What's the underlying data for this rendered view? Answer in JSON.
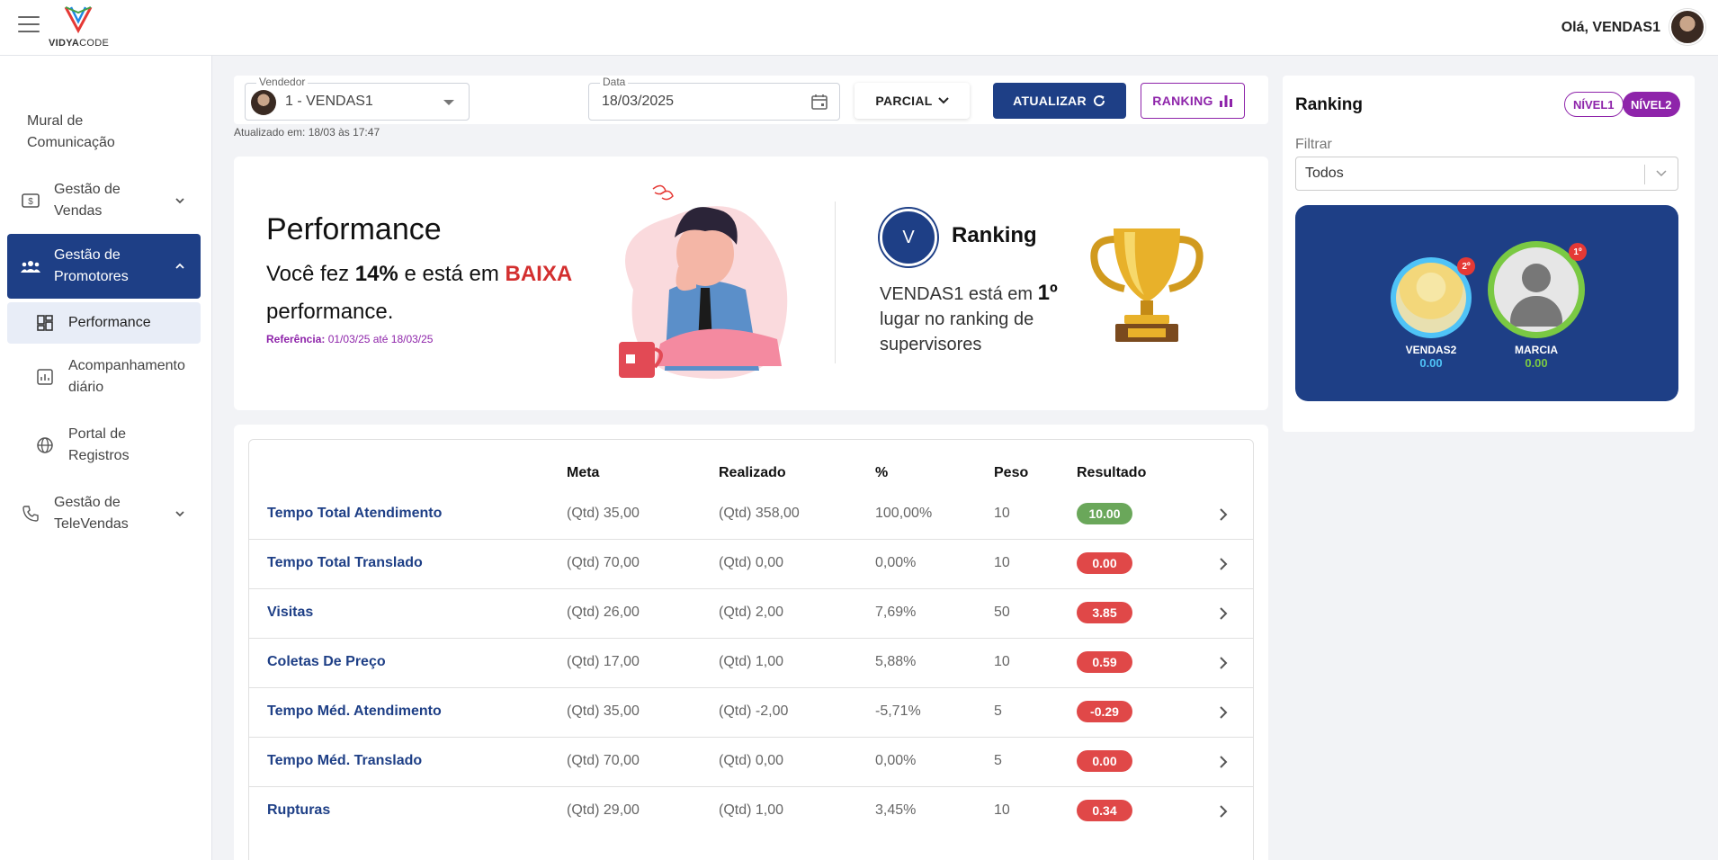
{
  "header": {
    "logo_brand": "VIDYA",
    "logo_brand_light": "CODE",
    "greeting": "Olá, VENDAS1"
  },
  "sidebar": {
    "items": [
      {
        "label": "Mural de Comunicação",
        "icon": "none"
      },
      {
        "label": "Gestão de Vendas",
        "icon": "dollar-icon"
      },
      {
        "label": "Gestão de Promotores",
        "icon": "users-icon"
      },
      {
        "label": "Performance",
        "icon": "dashboard-icon"
      },
      {
        "label": "Acompanhamento diário",
        "icon": "chart-icon"
      },
      {
        "label": "Portal de Registros",
        "icon": "globe-icon"
      },
      {
        "label": "Gestão de TeleVendas",
        "icon": "phone-icon"
      }
    ]
  },
  "filters": {
    "vendedor_label": "Vendedor",
    "vendedor_value": "1 - VENDAS1",
    "data_label": "Data",
    "data_value": "18/03/2025",
    "parcial_label": "PARCIAL",
    "atualizar_label": "ATUALIZAR",
    "ranking_label": "RANKING",
    "updated_text": "Atualizado em: 18/03 às 17:47"
  },
  "performance": {
    "title": "Performance",
    "line_prefix": "Você fez ",
    "percent": "14%",
    "line_mid": " e está em ",
    "level": "BAIXA",
    "line_suffix": "performance.",
    "ref_label": "Referência:",
    "ref_range": " 01/03/25 até 18/03/25",
    "badge_letter": "V",
    "ranking_title": "Ranking",
    "ranking_text_prefix": "VENDAS1 está em ",
    "ranking_position": "1º",
    "ranking_text_suffix": " lugar no ranking de supervisores"
  },
  "table": {
    "headers": {
      "meta": "Meta",
      "realizado": "Realizado",
      "pct": "%",
      "peso": "Peso",
      "resultado": "Resultado"
    },
    "rows": [
      {
        "name": "Tempo Total Atendimento",
        "meta": "(Qtd) 35,00",
        "realizado": "(Qtd) 358,00",
        "pct": "100,00%",
        "peso": "10",
        "resultado": "10.00",
        "status": "good"
      },
      {
        "name": "Tempo Total Translado",
        "meta": "(Qtd) 70,00",
        "realizado": "(Qtd) 0,00",
        "pct": "0,00%",
        "peso": "10",
        "resultado": "0.00",
        "status": "bad"
      },
      {
        "name": "Visitas",
        "meta": "(Qtd) 26,00",
        "realizado": "(Qtd) 2,00",
        "pct": "7,69%",
        "peso": "50",
        "resultado": "3.85",
        "status": "bad"
      },
      {
        "name": "Coletas De Preço",
        "meta": "(Qtd) 17,00",
        "realizado": "(Qtd) 1,00",
        "pct": "5,88%",
        "peso": "10",
        "resultado": "0.59",
        "status": "bad"
      },
      {
        "name": "Tempo Méd. Atendimento",
        "meta": "(Qtd) 35,00",
        "realizado": "(Qtd) -2,00",
        "pct": "-5,71%",
        "peso": "5",
        "resultado": "-0.29",
        "status": "bad"
      },
      {
        "name": "Tempo Méd. Translado",
        "meta": "(Qtd) 70,00",
        "realizado": "(Qtd) 0,00",
        "pct": "0,00%",
        "peso": "5",
        "resultado": "0.00",
        "status": "bad"
      },
      {
        "name": "Rupturas",
        "meta": "(Qtd) 29,00",
        "realizado": "(Qtd) 1,00",
        "pct": "3,45%",
        "peso": "10",
        "resultado": "0.34",
        "status": "bad"
      }
    ]
  },
  "ranking_panel": {
    "title": "Ranking",
    "level1": "NÍVEL1",
    "level2": "NÍVEL2",
    "filter_label": "Filtrar",
    "filter_value": "Todos",
    "podium": [
      {
        "name": "VENDAS2",
        "value": "0.00",
        "place": "2º"
      },
      {
        "name": "MARCIA",
        "value": "0.00",
        "place": "1º"
      }
    ]
  },
  "colors": {
    "primary": "#1e3f86",
    "accent": "#8e24aa",
    "good": "#6aa75a",
    "bad": "#e04848",
    "first_place": "#7ac943",
    "second_place": "#4fc3f7"
  }
}
